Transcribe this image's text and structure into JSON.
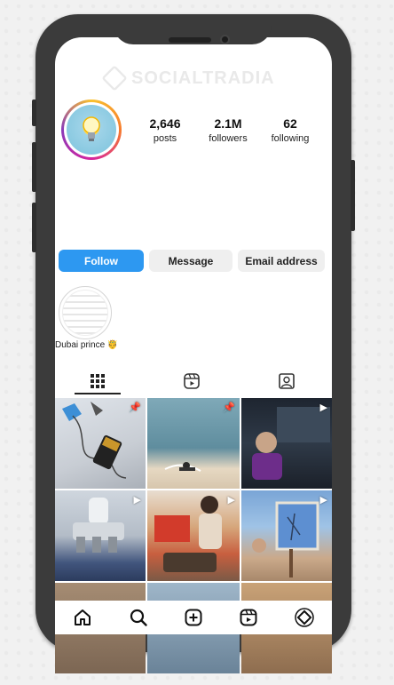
{
  "watermark": {
    "text": "SOCIALTRADIA"
  },
  "profile": {
    "avatar_icon": "lightbulb-icon",
    "stats": [
      {
        "value": "2,646",
        "label": "posts"
      },
      {
        "value": "2.1M",
        "label": "followers"
      },
      {
        "value": "62",
        "label": "following"
      }
    ]
  },
  "actions": {
    "follow": "Follow",
    "message": "Message",
    "email": "Email address"
  },
  "highlights": [
    {
      "label": "Dubai prince 🤴"
    }
  ],
  "tabs": [
    "grid-icon",
    "reels-icon",
    "tagged-icon"
  ],
  "posts": [
    {
      "marker": "pin-icon"
    },
    {
      "marker": "pin-icon"
    },
    {
      "marker": "reel-icon"
    },
    {
      "marker": "reel-icon"
    },
    {
      "marker": "reel-icon"
    },
    {
      "marker": "reel-icon"
    },
    {
      "marker": ""
    },
    {
      "marker": ""
    },
    {
      "marker": ""
    }
  ],
  "bottom_nav": [
    "home-icon",
    "search-icon",
    "create-icon",
    "reels-icon",
    "profile-icon"
  ],
  "colors": {
    "follow": "#2d98f1",
    "frame": "#3b3b3b"
  }
}
